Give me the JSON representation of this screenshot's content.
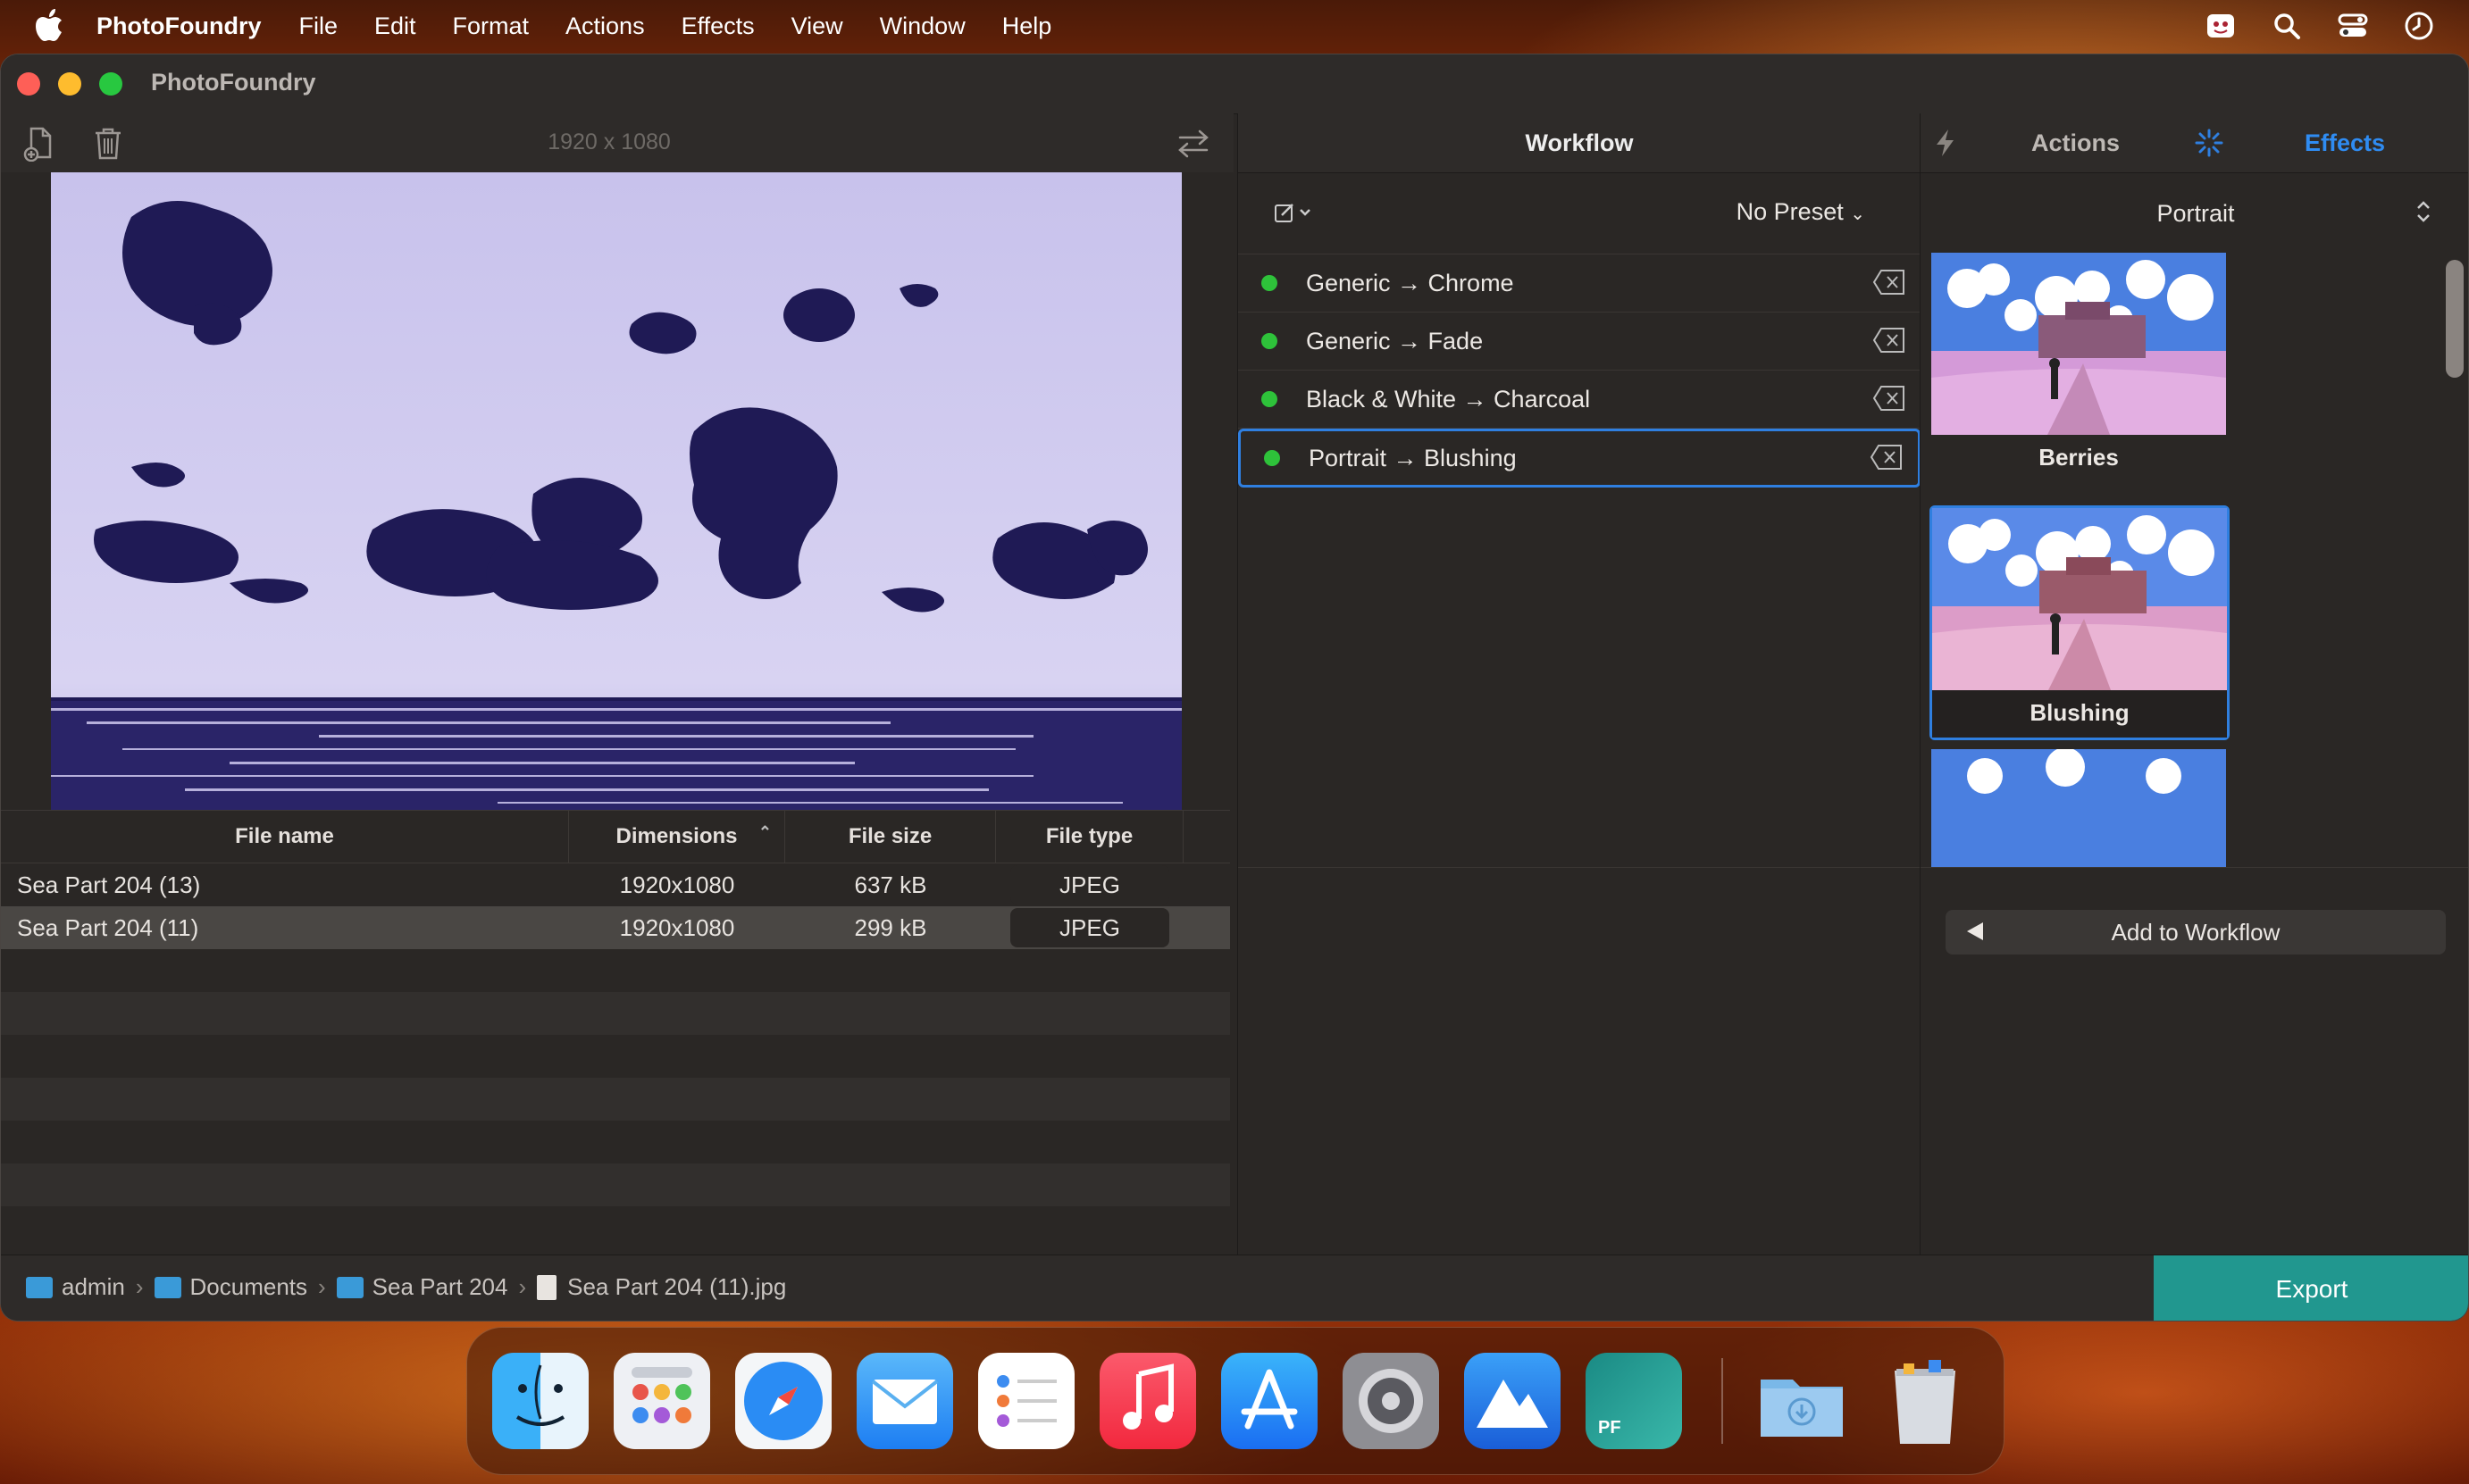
{
  "menubar": {
    "app_name": "PhotoFoundry",
    "items": [
      "File",
      "Edit",
      "Format",
      "Actions",
      "Effects",
      "View",
      "Window",
      "Help"
    ]
  },
  "window": {
    "title": "PhotoFoundry"
  },
  "preview": {
    "dimensions_label": "1920 x 1080"
  },
  "table": {
    "headers": [
      "File name",
      "Dimensions",
      "File size",
      "File type"
    ],
    "rows": [
      {
        "name": "Sea Part 204 (13)",
        "dims": "1920x1080",
        "size": "637 kB",
        "type": "JPEG"
      },
      {
        "name": "Sea Part 204 (11)",
        "dims": "1920x1080",
        "size": "299 kB",
        "type": "JPEG"
      }
    ],
    "selected_row": 1
  },
  "workflow": {
    "title": "Workflow",
    "preset": "No Preset",
    "items": [
      {
        "label": "Generic → Chrome"
      },
      {
        "label": "Generic → Fade"
      },
      {
        "label": "Black & White → Charcoal"
      },
      {
        "label": "Portrait → Blushing"
      }
    ],
    "selected_index": 3
  },
  "right_panel": {
    "tab_actions": "Actions",
    "tab_effects": "Effects",
    "active_tab": "Effects",
    "category": "Portrait",
    "effects": [
      {
        "label": "Berries"
      },
      {
        "label": "Blushing"
      }
    ],
    "selected_effect": "Blushing",
    "add_button": "Add to Workflow"
  },
  "statusbar": {
    "path": [
      "admin",
      "Documents",
      "Sea Part 204",
      "Sea Part 204 (11).jpg"
    ],
    "export_label": "Export"
  },
  "dock": {
    "apps": [
      "finder-icon",
      "launchpad-icon",
      "safari-icon",
      "mail-icon",
      "reminders-icon",
      "music-icon",
      "app-store-icon",
      "system-settings-icon",
      "photo-app-icon",
      "photofoundry-icon",
      "downloads-icon",
      "trash-icon"
    ],
    "dock_label_pf": "PF"
  },
  "colors": {
    "accent": "#2f7fe0",
    "export": "#21978f",
    "status_dot": "#2ec23a"
  }
}
